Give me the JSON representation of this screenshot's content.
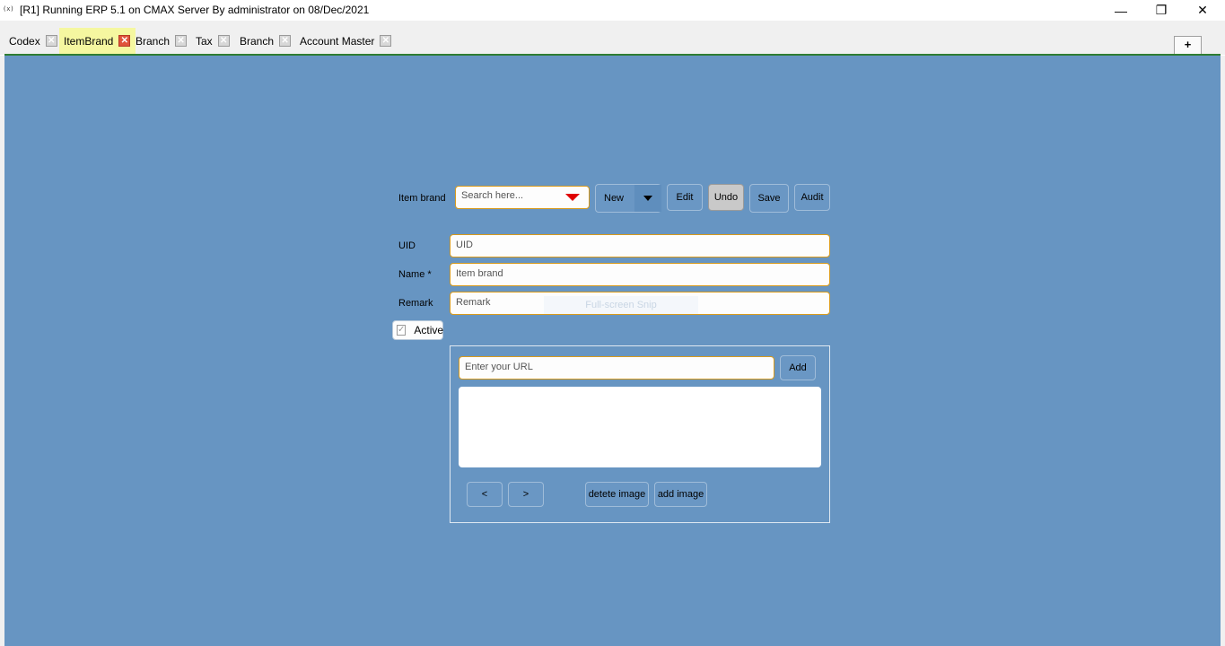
{
  "window": {
    "app_icon": "(x)",
    "title": "[R1] Running ERP 5.1 on CMAX Server By administrator on 08/Dec/2021",
    "minimize_glyph": "—",
    "maximize_glyph": "❐",
    "close_glyph": "✕"
  },
  "tabs": [
    {
      "label": "Codex",
      "active": false
    },
    {
      "label": "ItemBrand",
      "active": true
    },
    {
      "label": "Branch",
      "active": false
    },
    {
      "label": "Tax",
      "active": false
    },
    {
      "label": "Branch",
      "active": false
    },
    {
      "label": "Account Master",
      "active": false
    }
  ],
  "tab_close_glyph": "✕",
  "add_tab_label": "+",
  "toolbar": {
    "item_brand_label": "Item brand",
    "search_placeholder": "Search here...",
    "new_label": "New",
    "edit_label": "Edit",
    "undo_label": "Undo",
    "save_label": "Save",
    "audit_label": "Audit"
  },
  "form": {
    "uid_label": "UID",
    "uid_placeholder": "UID",
    "name_label": "Name *",
    "name_placeholder": "Item brand",
    "remark_label": "Remark",
    "remark_placeholder": "Remark",
    "active_label": "Active",
    "active_checked": true,
    "check_glyph": "✓"
  },
  "overlay_text": "Full-screen Snip",
  "images": {
    "url_placeholder": "Enter your URL",
    "add_label": "Add",
    "prev_label": "<",
    "next_label": ">",
    "delete_label": "detete image",
    "add_image_label": "add image"
  },
  "colors": {
    "panel_bg": "#6795c2",
    "active_tab_bg": "#f5f7a0",
    "field_border": "#d79a1c",
    "tab_rule": "#2e7d32"
  }
}
